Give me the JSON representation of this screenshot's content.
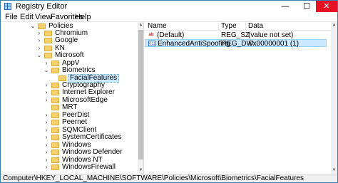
{
  "window": {
    "title": "Registry Editor",
    "minimize": "—",
    "maximize": "☐",
    "close": "✕"
  },
  "menu": [
    "File",
    "Edit",
    "View",
    "Favorites",
    "Help"
  ],
  "tree": {
    "items": [
      {
        "label": "Policies",
        "expander": "⌄",
        "selected": false
      },
      {
        "label": "Chromium",
        "expander": "›",
        "selected": false
      },
      {
        "label": "Google",
        "expander": "›",
        "selected": false
      },
      {
        "label": "KN",
        "expander": "›",
        "selected": false
      },
      {
        "label": "Microsoft",
        "expander": "⌄",
        "selected": false
      },
      {
        "label": "AppV",
        "expander": "›",
        "selected": false
      },
      {
        "label": "Biometrics",
        "expander": "⌄",
        "selected": false
      },
      {
        "label": "FacialFeatures",
        "expander": "",
        "selected": true
      },
      {
        "label": "Cryptography",
        "expander": "›",
        "selected": false
      },
      {
        "label": "Internet Explorer",
        "expander": "›",
        "selected": false
      },
      {
        "label": "MicrosoftEdge",
        "expander": "›",
        "selected": false
      },
      {
        "label": "MRT",
        "expander": "",
        "selected": false
      },
      {
        "label": "PeerDist",
        "expander": "›",
        "selected": false
      },
      {
        "label": "Peernet",
        "expander": "›",
        "selected": false
      },
      {
        "label": "SQMClient",
        "expander": "›",
        "selected": false
      },
      {
        "label": "SystemCertificates",
        "expander": "›",
        "selected": false
      },
      {
        "label": "Windows",
        "expander": "›",
        "selected": false
      },
      {
        "label": "Windows Defender",
        "expander": "›",
        "selected": false
      },
      {
        "label": "Windows NT",
        "expander": "›",
        "selected": false
      },
      {
        "label": "WindowsFirewall",
        "expander": "›",
        "selected": false
      }
    ]
  },
  "values": {
    "headers": {
      "name": "Name",
      "type": "Type",
      "data": "Data"
    },
    "rows": [
      {
        "icon": "ab",
        "name": "(Default)",
        "type": "REG_SZ",
        "data": "(value not set)",
        "selected": false
      },
      {
        "icon": "011",
        "name": "EnhancedAntiSpoofing",
        "type": "REG_DW...",
        "data": "0x00000001 (1)",
        "selected": true
      }
    ]
  },
  "status": {
    "path": "Computer\\HKEY_LOCAL_MACHINE\\SOFTWARE\\Policies\\Microsoft\\Biometrics\\FacialFeatures"
  },
  "colors": {
    "selection": "#cce8ff",
    "close_button": "#e81123",
    "folder": "#f5d16b",
    "window_border": "#3c7fb1"
  }
}
